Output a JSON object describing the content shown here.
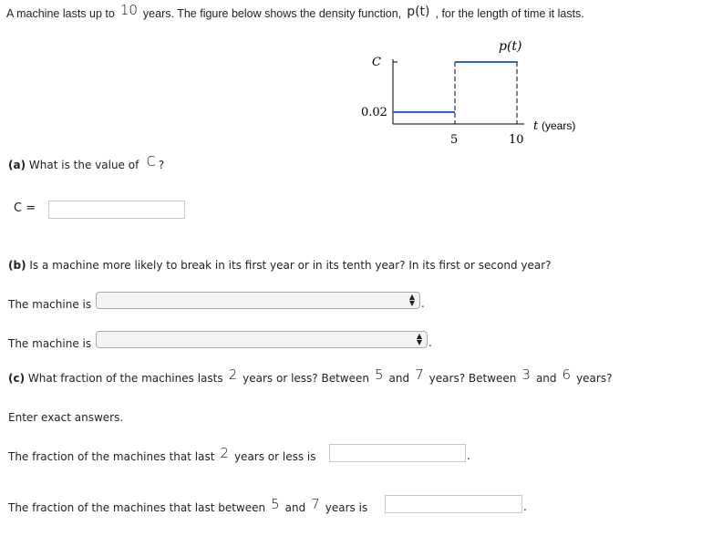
{
  "problem": {
    "intro": {
      "part1": "A machine lasts up to",
      "max_years": "10",
      "part2": "years. The figure below shows the density function,",
      "function_name": "p(t)",
      "part3": ", for the length of time it lasts."
    },
    "figure": {
      "title": "p(t)",
      "y_label_top": "C",
      "y_label_low": "0.02",
      "x_label": "t",
      "x_unit": "(years)",
      "x_ticks": [
        "5",
        "10"
      ]
    },
    "part_a": {
      "label": "(a)",
      "question": "What is the value of",
      "symbol": "C",
      "question_end": "?",
      "input_label": "C =",
      "input_value": ""
    },
    "part_b": {
      "label": "(b)",
      "question": "Is a machine more likely to break in its first year or in its tenth year? In its first or second year?",
      "select1_label": "The machine is",
      "select1_value": "",
      "select2_label": "The machine is",
      "select2_value": "",
      "period": "."
    },
    "part_c": {
      "label": "(c)",
      "q1": "What fraction of the machines lasts",
      "n1": "2",
      "q2": "years or less? Between",
      "n2": "5",
      "q3": "and",
      "n3": "7",
      "q4": "years? Between",
      "n4": "3",
      "q5": "and",
      "n5": "6",
      "q6": "years?",
      "instruction": "Enter exact answers.",
      "ans1_pre": "The fraction of the machines that last",
      "ans1_n": "2",
      "ans1_post": "years or less is",
      "ans1_value": "",
      "ans2_pre": "The fraction of the machines that last between",
      "ans2_n1": "5",
      "ans2_and": "and",
      "ans2_n2": "7",
      "ans2_post": "years is",
      "ans2_value": "",
      "period": "."
    }
  },
  "chart_data": {
    "type": "line",
    "title": "p(t)",
    "xlabel": "t (years)",
    "ylabel": "",
    "x_ticks": [
      5,
      10
    ],
    "y_ticks": [
      "0.02",
      "C"
    ],
    "series": [
      {
        "name": "p(t)",
        "segments": [
          {
            "x": [
              0,
              5
            ],
            "y": "0.02"
          },
          {
            "x": [
              5,
              10
            ],
            "y": "C"
          }
        ]
      }
    ],
    "dashed_verticals": [
      5,
      10
    ],
    "color": "#2f5fd0"
  }
}
